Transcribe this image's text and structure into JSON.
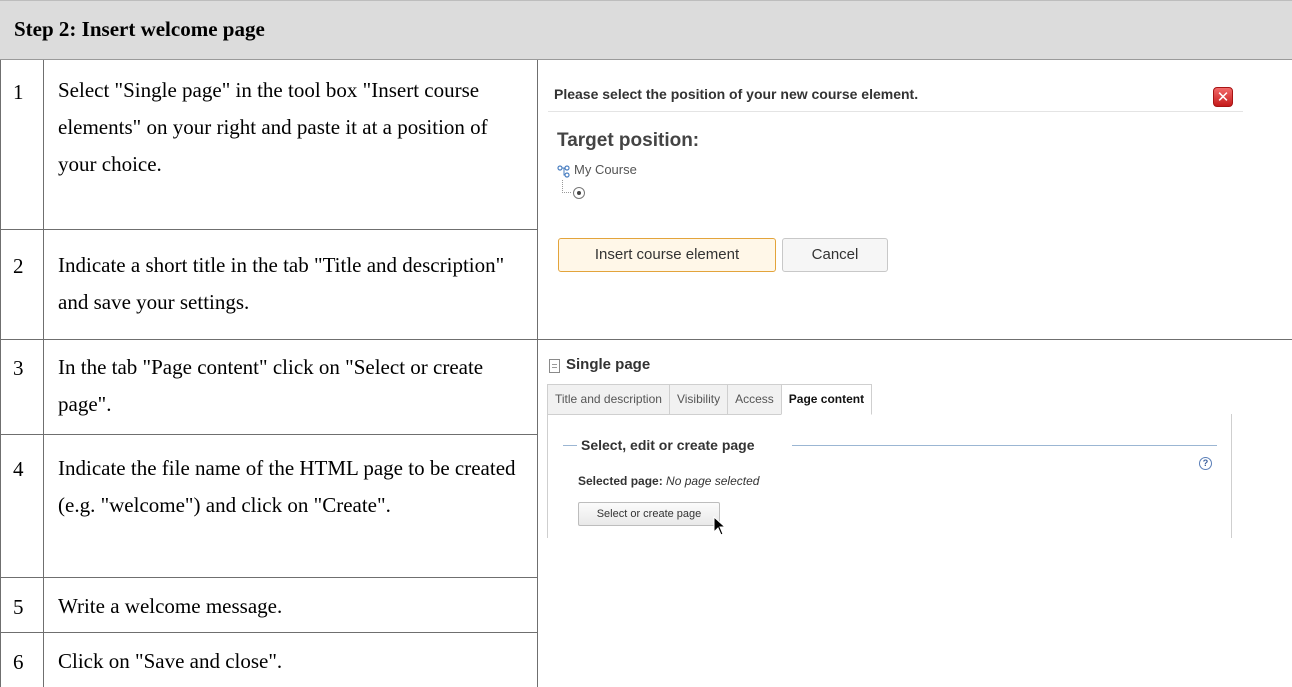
{
  "header": {
    "title": "Step 2: Insert welcome page"
  },
  "steps": [
    {
      "num": "1",
      "text": "Select \"Single page\" in the tool box \"Insert course elements\" on your right and paste it at a position of your choice."
    },
    {
      "num": "2",
      "text": "Indicate a short title in the tab \"Title and description\" and save your settings."
    },
    {
      "num": "3",
      "text": "In the tab \"Page content\" click on \"Select or create page\"."
    },
    {
      "num": "4",
      "text": "Indicate the file name of the HTML page to be created (e.g. \"welcome\") and click on \"Create\"."
    },
    {
      "num": "5",
      "text": "Write a welcome message."
    },
    {
      "num": "6",
      "text": "Click on \"Save and close\"."
    }
  ],
  "dialog": {
    "title": "Please select the position of your new course element.",
    "close_icon": "close-icon",
    "target_heading": "Target position:",
    "tree_root": "My Course",
    "insert_label": "Insert course element",
    "cancel_label": "Cancel"
  },
  "single_page": {
    "title": "Single page",
    "tabs": [
      "Title and description",
      "Visibility",
      "Access",
      "Page content"
    ],
    "active_tab": "Page content",
    "fieldset_legend": "Select, edit or create page",
    "selected_label": "Selected page:",
    "selected_value": "No page selected",
    "select_button": "Select or create page",
    "help_icon": "help-icon"
  },
  "colors": {
    "header_bg": "#dcdcdc",
    "close_red": "#d42a2a",
    "insert_border": "#e3a43b"
  }
}
